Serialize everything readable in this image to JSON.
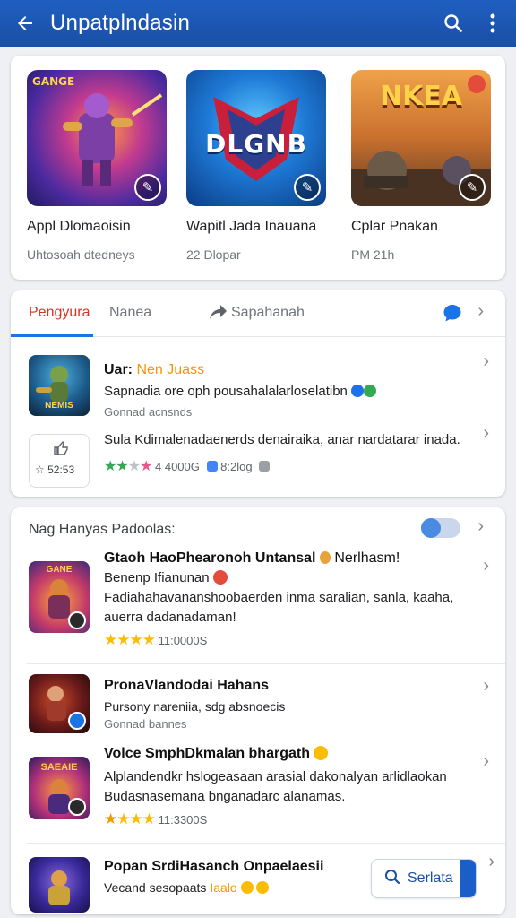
{
  "appbar": {
    "title": "Unpatplndasin"
  },
  "featured": [
    {
      "name": "Appl Dlomaoisin",
      "meta": "Uhtosoah dtedneys",
      "art_title": "GANGE",
      "art_tag": ""
    },
    {
      "name": "Wapitl Jada Inauana",
      "meta": "22 Dlopar",
      "art_title": "DLGNB",
      "art_tag": ""
    },
    {
      "name": "Cplar Pnakan",
      "meta": "PM 21h",
      "art_title": "NKEA",
      "art_tag": ""
    }
  ],
  "tabs": [
    "Pengyura",
    "Nanea",
    "Sapahanah"
  ],
  "list1": {
    "item1": {
      "title_prefix": "Uar:",
      "title_highlight": "Nen Juass",
      "line": "Sapnadia ore oph pousahalalarloselatibn",
      "sub": "Gonnad acnsnds",
      "art": "NEMIS"
    },
    "item2": {
      "line": "Sula Kdimalenadaenerds denairaika, anar nardatarar inada.",
      "rating_text": "52:53",
      "count": "4 4000G",
      "size": "8:2log"
    }
  },
  "section2": {
    "header": "Nag  Hanyas Padoolas:",
    "items": [
      {
        "title": "Gtaoh HaoPhearonoh Untansal",
        "title_tail": "Nerlhasm!",
        "line1": "Benenp Ifianunan",
        "line2": "Fadiahahavananshoobaerden inma saralian, sanla, kaaha,",
        "line3": "auerra dadanadaman!",
        "count": "11:0000S",
        "art": "GANE"
      },
      {
        "title": "PronaVlandodai Hahans",
        "line1": "Pursony nareniia, sdg absnoecis",
        "sub": "Gonnad bannes",
        "art": ""
      },
      {
        "title": "Volce SmphDkmalan bhargath",
        "line1": "Alplandendkr hslogeasaan arasial dakonalyan arlidlaokan",
        "line2": "Budasnasemana bnganadarc alanamas.",
        "count": "11:3300S",
        "art": "SAEAIE"
      },
      {
        "title": "Popan SrdiHasanch Onpaelaesii",
        "line1_prefix": "Vecand sesopaats",
        "line1_highlight": "Iaalo",
        "button": "Serlata",
        "art": ""
      }
    ]
  }
}
